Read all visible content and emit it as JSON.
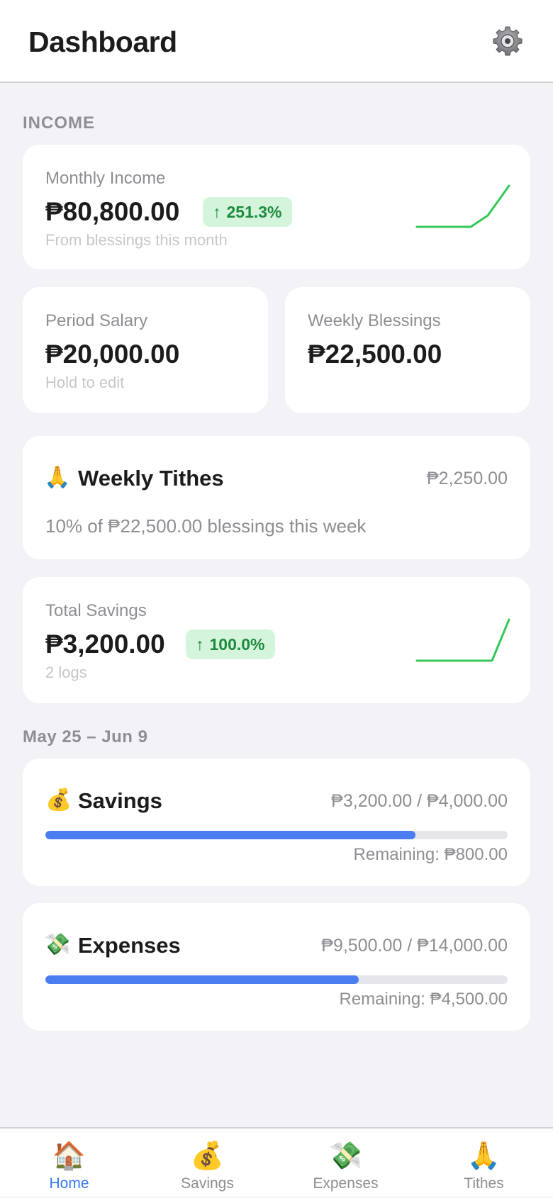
{
  "header": {
    "title": "Dashboard",
    "settings_icon": "gear-icon"
  },
  "income_section_label": "INCOME",
  "monthly_income": {
    "label": "Monthly Income",
    "amount": "₱80,800.00",
    "change": "251.3%",
    "change_icon": "arrow-up-icon",
    "note": "From blessings this month",
    "trend_color": "#34c759"
  },
  "period_salary": {
    "label": "Period Salary",
    "amount": "₱20,000.00",
    "note": "Hold to edit"
  },
  "weekly_blessings": {
    "label": "Weekly Blessings",
    "amount": "₱22,500.00"
  },
  "weekly_tithes": {
    "emoji": "🙏",
    "title": "Weekly Tithes",
    "amount": "₱2,250.00",
    "note": "10% of ₱22,500.00 blessings this week"
  },
  "total_savings": {
    "label": "Total Savings",
    "amount": "₱3,200.00",
    "change": "100.0%",
    "change_icon": "arrow-up-icon",
    "note": "2 logs"
  },
  "period_label": "May 25 – Jun 9",
  "budgets": {
    "savings": {
      "emoji": "💰",
      "title": "Savings",
      "amount": "₱3,200.00 / ₱4,000.00",
      "progress": 0.8,
      "remaining": "Remaining: ₱800.00"
    },
    "expenses": {
      "emoji": "💸",
      "title": "Expenses",
      "amount": "₱9,500.00 / ₱14,000.00",
      "progress": 0.6786,
      "remaining": "Remaining: ₱4,500.00"
    }
  },
  "colors": {
    "accent": "#3478f6",
    "progress": "#4a7ef0",
    "positive": "#1d8a3c",
    "positive_bg": "#d4f5dc"
  },
  "tabs": [
    {
      "emoji": "🏠",
      "label": "Home",
      "active": true
    },
    {
      "emoji": "💰",
      "label": "Savings",
      "active": false
    },
    {
      "emoji": "💸",
      "label": "Expenses",
      "active": false
    },
    {
      "emoji": "🙏",
      "label": "Tithes",
      "active": false
    }
  ]
}
